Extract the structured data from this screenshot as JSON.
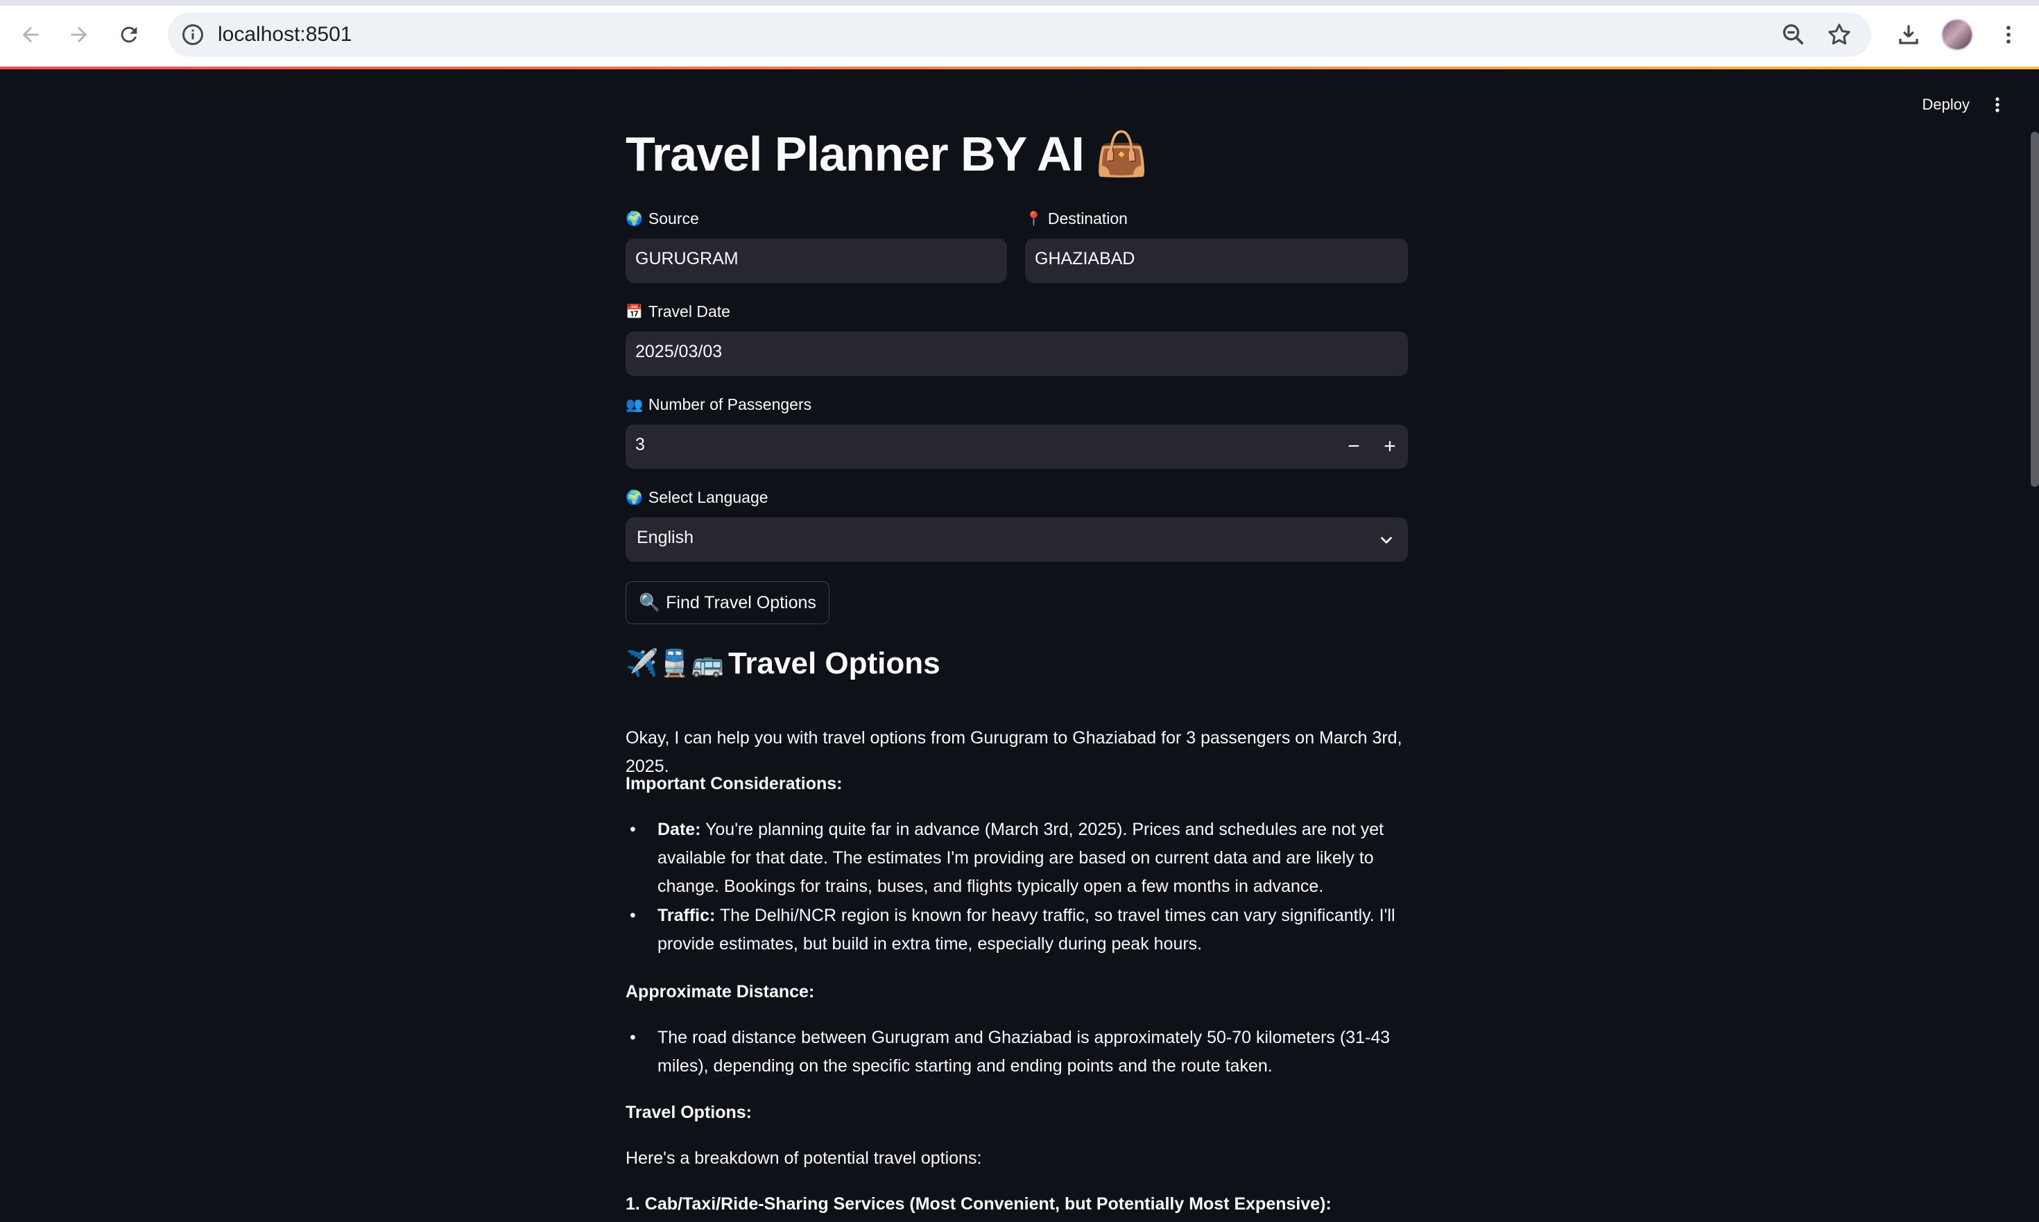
{
  "browser": {
    "url": "localhost:8501"
  },
  "header": {
    "deploy_label": "Deploy"
  },
  "app": {
    "title": "Travel Planner BY AI",
    "title_emoji": "👜",
    "source": {
      "label": "Source",
      "emoji": "🌍",
      "value": "GURUGRAM"
    },
    "destination": {
      "label": "Destination",
      "emoji": "📍",
      "value": "GHAZIABAD"
    },
    "travel_date": {
      "label": "Travel Date",
      "emoji": "📅",
      "value": "2025/03/03"
    },
    "passengers": {
      "label": "Number of Passengers",
      "emoji": "👥",
      "value": "3",
      "minus": "−",
      "plus": "+"
    },
    "language": {
      "label": "Select Language",
      "emoji": "🌍",
      "value": "English"
    },
    "find_button": {
      "emoji": "🔍",
      "label": "Find Travel Options"
    },
    "results": {
      "heading_emojis": "✈️🚆🚌",
      "heading": "Travel Options",
      "intro": "Okay, I can help you with travel options from Gurugram to Ghaziabad for 3 passengers on March 3rd, 2025.",
      "considerations_heading": "Important Considerations:",
      "considerations": [
        {
          "term": "Date:",
          "text": " You're planning quite far in advance (March 3rd, 2025). Prices and schedules are not yet available for that date. The estimates I'm providing are based on current data and are likely to change. Bookings for trains, buses, and flights typically open a few months in advance."
        },
        {
          "term": "Traffic:",
          "text": " The Delhi/NCR region is known for heavy traffic, so travel times can vary significantly. I'll provide estimates, but build in extra time, especially during peak hours."
        }
      ],
      "distance_heading": "Approximate Distance:",
      "distance_text": "The road distance between Gurugram and Ghaziabad is approximately 50-70 kilometers (31-43 miles), depending on the specific starting and ending points and the route taken.",
      "options_heading": "Travel Options:",
      "options_intro": "Here's a breakdown of potential travel options:",
      "option_1": "1. Cab/Taxi/Ride-Sharing Services (Most Convenient, but Potentially Most Expensive):"
    }
  }
}
